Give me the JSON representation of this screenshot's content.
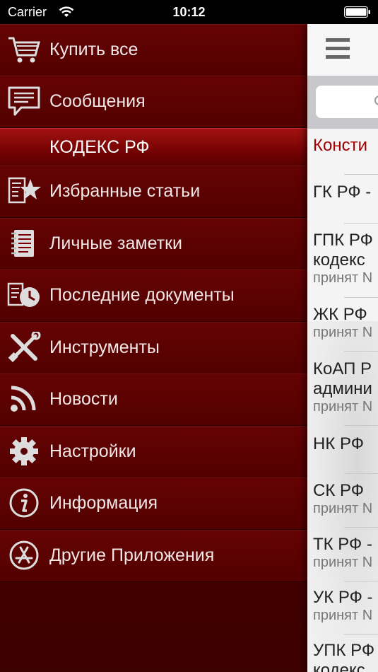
{
  "status_bar": {
    "carrier": "Carrier",
    "time": "10:12"
  },
  "menu": {
    "items": [
      {
        "label": "Купить все",
        "icon": "cart-icon"
      },
      {
        "label": "Сообщения",
        "icon": "message-icon"
      }
    ],
    "section_header": "КОДЕКС РФ",
    "items2": [
      {
        "label": "Избранные статьи",
        "icon": "star-document-icon"
      },
      {
        "label": "Личные заметки",
        "icon": "notebook-icon"
      },
      {
        "label": "Последние документы",
        "icon": "recent-docs-icon"
      },
      {
        "label": "Инструменты",
        "icon": "tools-icon"
      },
      {
        "label": "Новости",
        "icon": "rss-icon"
      },
      {
        "label": "Настройки",
        "icon": "gear-icon"
      },
      {
        "label": "Информация",
        "icon": "info-icon"
      },
      {
        "label": "Другие Приложения",
        "icon": "app-store-icon"
      }
    ]
  },
  "content": {
    "active_row": "Консти",
    "rows": [
      {
        "title": "ГК РФ -",
        "line2": "",
        "sub": ""
      },
      {
        "title": "ГПК РФ",
        "line2": "кодекс",
        "sub": "принят N"
      },
      {
        "title": "ЖК РФ",
        "line2": "",
        "sub": "принят N"
      },
      {
        "title": "КоАП Р",
        "line2": "админи",
        "sub": "принят N"
      },
      {
        "title": "НК РФ",
        "line2": "",
        "sub": ""
      },
      {
        "title": "СК РФ",
        "line2": "",
        "sub": "принят N"
      },
      {
        "title": "ТК РФ -",
        "line2": "",
        "sub": "принят N"
      },
      {
        "title": "УК РФ -",
        "line2": "",
        "sub": "принят N"
      },
      {
        "title": "УПК РФ",
        "line2": "кодекс",
        "sub": ""
      }
    ]
  },
  "colors": {
    "menu_bg": "#5a0000",
    "section_bg": "#a31212",
    "active_text": "#a00000"
  }
}
